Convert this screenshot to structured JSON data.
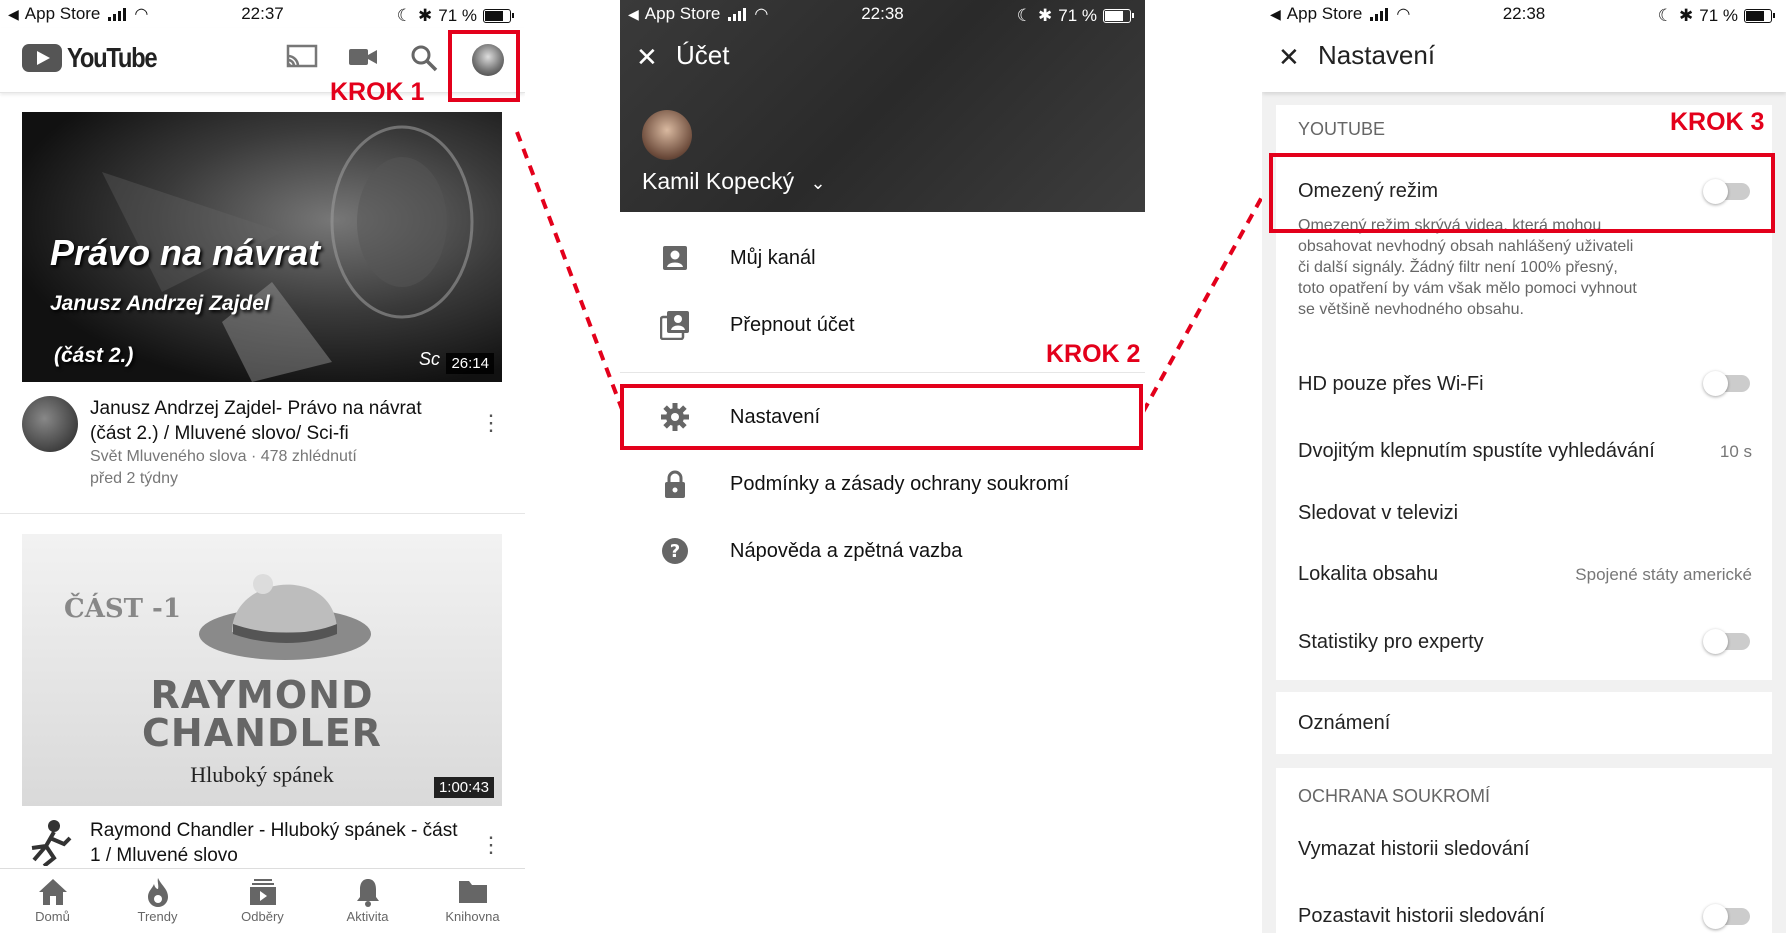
{
  "steps": {
    "step1": "KROK 1",
    "step2": "KROK 2",
    "step3": "KROK 3"
  },
  "status": [
    {
      "back": "◀",
      "app": "App Store",
      "time": "22:37",
      "battery": "71 %"
    },
    {
      "back": "◀",
      "app": "App Store",
      "time": "22:38",
      "battery": "71 %"
    },
    {
      "back": "◀",
      "app": "App Store",
      "time": "22:38",
      "battery": "71 %"
    }
  ],
  "home": {
    "logo": "YouTube",
    "icons": [
      "cast-icon",
      "camera-icon",
      "search-icon",
      "account-avatar"
    ],
    "videos": [
      {
        "thumb_title": "Právo na návrat",
        "thumb_subtitle": "Janusz Andrzej Zajdel",
        "thumb_part": "(část 2.)",
        "thumb_corner": "Sc",
        "duration": "26:14",
        "title": "Janusz Andrzej Zajdel- Právo na návrat (část 2.) / Mluvené slovo/ Sci-fi",
        "channel_views": "Svět Mluveného slova · 478 zhlédnutí",
        "age": "před 2 týdny"
      },
      {
        "thumb_part": "ČÁST -1",
        "thumb_name_1": "RAYMOND",
        "thumb_name_2": "CHANDLER",
        "thumb_subtitle": "Hluboký spánek",
        "duration": "1:00:43",
        "title": "Raymond Chandler - Hluboký spánek - část 1 / Mluvené slovo"
      }
    ],
    "tabs": [
      {
        "label": "Domů",
        "icon": "home-icon"
      },
      {
        "label": "Trendy",
        "icon": "flame-icon"
      },
      {
        "label": "Odběry",
        "icon": "subscriptions-icon"
      },
      {
        "label": "Aktivita",
        "icon": "bell-icon"
      },
      {
        "label": "Knihovna",
        "icon": "folder-icon"
      }
    ]
  },
  "account": {
    "title": "Účet",
    "name": "Kamil Kopecký",
    "items": [
      {
        "label": "Můj kanál",
        "icon": "person-icon"
      },
      {
        "label": "Přepnout účet",
        "icon": "switch-account-icon"
      },
      {
        "label": "Nastavení",
        "icon": "gear-icon"
      },
      {
        "label": "Podmínky a zásady ochrany soukromí",
        "icon": "lock-icon"
      },
      {
        "label": "Nápověda a zpětná vazba",
        "icon": "help-icon"
      }
    ]
  },
  "settings": {
    "title": "Nastavení",
    "section_youtube": "YOUTUBE",
    "restricted_mode": "Omezený režim",
    "restricted_desc_1": "Omezený režim skrývá videa, která mohou",
    "restricted_desc_2": "obsahovat nevhodný obsah nahlášený uživateli",
    "restricted_desc_3": "či další signály. Žádný filtr není 100% přesný,",
    "restricted_desc_4": "toto opatření by vám však mělo pomoci vyhnout",
    "restricted_desc_5": "se většině nevhodného obsahu.",
    "hd_wifi": "HD pouze přes Wi-Fi",
    "double_tap": "Dvojitým klepnutím spustíte vyhledávání",
    "double_tap_value": "10 s",
    "watch_tv": "Sledovat v televizi",
    "location": "Lokalita obsahu",
    "location_value": "Spojené státy americké",
    "stats": "Statistiky pro experty",
    "notifications": "Oznámení",
    "section_privacy": "OCHRANA SOUKROMÍ",
    "clear_history": "Vymazat historii sledování",
    "pause_history": "Pozastavit historii sledování"
  },
  "colors": {
    "highlight": "#e3001b"
  }
}
